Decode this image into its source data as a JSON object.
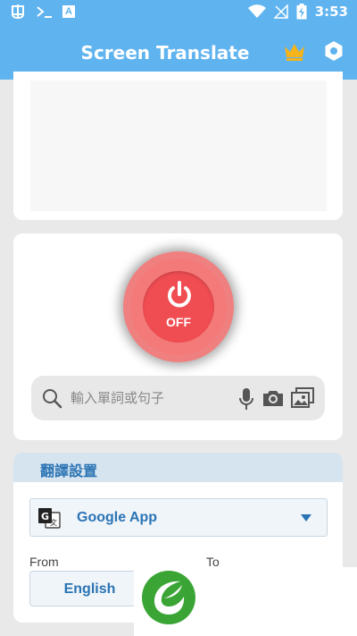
{
  "status_bar": {
    "time": "3:53",
    "a_badge": "A",
    "icons": [
      "notification-bug-icon",
      "terminal-icon",
      "a-badge-icon",
      "wifi-icon",
      "no-sim-icon",
      "battery-charging-icon"
    ]
  },
  "app_bar": {
    "title": "Screen Translate",
    "icons": [
      "crown-icon",
      "settings-gear-icon"
    ]
  },
  "power": {
    "state_label": "OFF"
  },
  "search": {
    "placeholder": "輸入單詞或句子",
    "icons": [
      "search-icon",
      "microphone-icon",
      "camera-icon",
      "image-icon"
    ]
  },
  "translation_settings": {
    "title": "翻譯設置",
    "engine": "Google App",
    "from_label": "From",
    "to_label": "To",
    "from_language": "English"
  },
  "colors": {
    "primary": "#5fb3ef",
    "accent_text": "#2a74b4",
    "power_red": "#f04d52",
    "crown": "#f4b41a",
    "logo_green": "#3aa535"
  }
}
